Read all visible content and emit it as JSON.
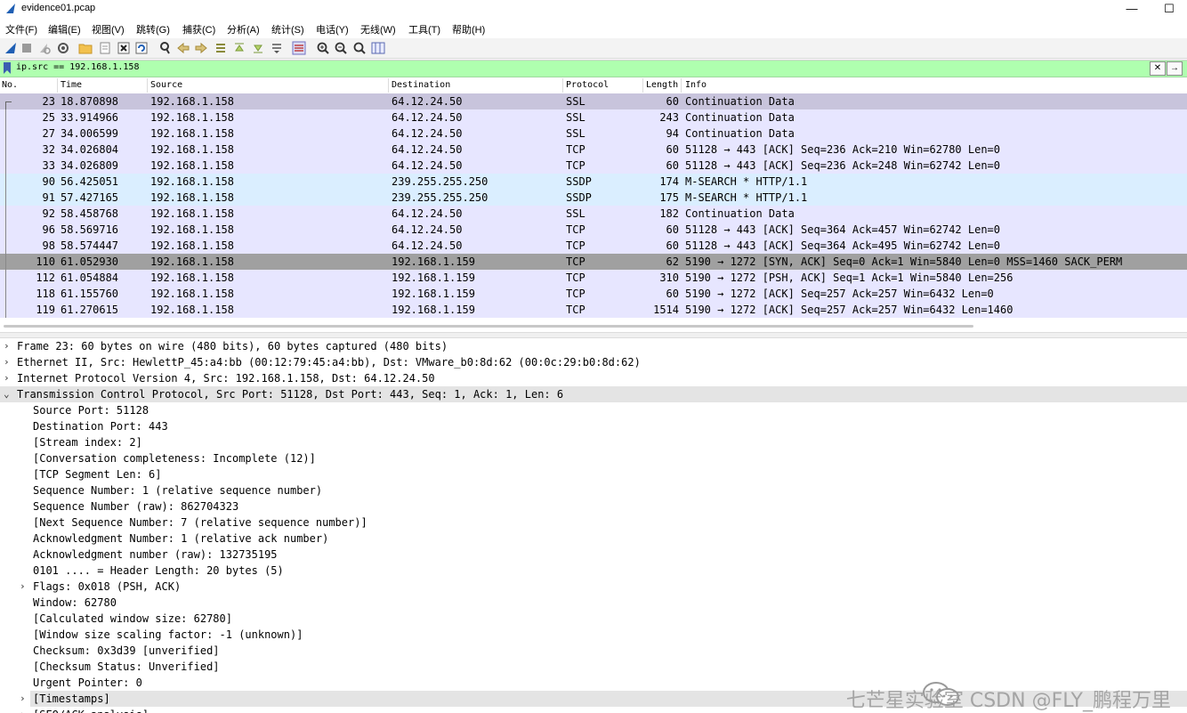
{
  "window": {
    "title": "evidence01.pcap",
    "minimize_glyph": "—",
    "maximize_glyph": "☐"
  },
  "menu": [
    "文件(F)",
    "编辑(E)",
    "视图(V)",
    "跳转(G)",
    "捕获(C)",
    "分析(A)",
    "统计(S)",
    "电话(Y)",
    "无线(W)",
    "工具(T)",
    "帮助(H)"
  ],
  "toolbar_icons": [
    "shark-fin-start-icon",
    "stop-icon",
    "restart-icon",
    "options-gear-icon",
    "open-folder-icon",
    "save-file-icon",
    "close-file-icon",
    "reload-icon",
    "find-packet-icon",
    "go-back-icon",
    "go-forward-icon",
    "go-to-packet-icon",
    "go-first-icon",
    "go-last-icon",
    "autoscroll-icon",
    "colorize-icon",
    "zoom-in-icon",
    "zoom-out-icon",
    "zoom-normal-icon",
    "resize-columns-icon"
  ],
  "filter": {
    "value": "ip.src == 192.168.1.158",
    "clear_glyph": "✕",
    "apply_glyph": "→"
  },
  "columns": {
    "no": "No.",
    "time": "Time",
    "source": "Source",
    "destination": "Destination",
    "protocol": "Protocol",
    "length": "Length",
    "info": "Info"
  },
  "packets": [
    {
      "no": "23",
      "time": "18.870898",
      "src": "192.168.1.158",
      "dst": "64.12.24.50",
      "proto": "SSL",
      "len": "60",
      "info": "Continuation Data",
      "style": "selected"
    },
    {
      "no": "25",
      "time": "33.914966",
      "src": "192.168.1.158",
      "dst": "64.12.24.50",
      "proto": "SSL",
      "len": "243",
      "info": "Continuation Data",
      "style": "tcp"
    },
    {
      "no": "27",
      "time": "34.006599",
      "src": "192.168.1.158",
      "dst": "64.12.24.50",
      "proto": "SSL",
      "len": "94",
      "info": "Continuation Data",
      "style": "tcp"
    },
    {
      "no": "32",
      "time": "34.026804",
      "src": "192.168.1.158",
      "dst": "64.12.24.50",
      "proto": "TCP",
      "len": "60",
      "info": "51128 → 443 [ACK] Seq=236 Ack=210 Win=62780 Len=0",
      "style": "tcp"
    },
    {
      "no": "33",
      "time": "34.026809",
      "src": "192.168.1.158",
      "dst": "64.12.24.50",
      "proto": "TCP",
      "len": "60",
      "info": "51128 → 443 [ACK] Seq=236 Ack=248 Win=62742 Len=0",
      "style": "tcp"
    },
    {
      "no": "90",
      "time": "56.425051",
      "src": "192.168.1.158",
      "dst": "239.255.255.250",
      "proto": "SSDP",
      "len": "174",
      "info": "M-SEARCH * HTTP/1.1",
      "style": "udp"
    },
    {
      "no": "91",
      "time": "57.427165",
      "src": "192.168.1.158",
      "dst": "239.255.255.250",
      "proto": "SSDP",
      "len": "175",
      "info": "M-SEARCH * HTTP/1.1",
      "style": "udp"
    },
    {
      "no": "92",
      "time": "58.458768",
      "src": "192.168.1.158",
      "dst": "64.12.24.50",
      "proto": "SSL",
      "len": "182",
      "info": "Continuation Data",
      "style": "tcp"
    },
    {
      "no": "96",
      "time": "58.569716",
      "src": "192.168.1.158",
      "dst": "64.12.24.50",
      "proto": "TCP",
      "len": "60",
      "info": "51128 → 443 [ACK] Seq=364 Ack=457 Win=62742 Len=0",
      "style": "tcp"
    },
    {
      "no": "98",
      "time": "58.574447",
      "src": "192.168.1.158",
      "dst": "64.12.24.50",
      "proto": "TCP",
      "len": "60",
      "info": "51128 → 443 [ACK] Seq=364 Ack=495 Win=62742 Len=0",
      "style": "tcp"
    },
    {
      "no": "110",
      "time": "61.052930",
      "src": "192.168.1.158",
      "dst": "192.168.1.159",
      "proto": "TCP",
      "len": "62",
      "info": "5190 → 1272 [SYN, ACK] Seq=0 Ack=1 Win=5840 Len=0 MSS=1460 SACK_PERM",
      "style": "syn"
    },
    {
      "no": "112",
      "time": "61.054884",
      "src": "192.168.1.158",
      "dst": "192.168.1.159",
      "proto": "TCP",
      "len": "310",
      "info": "5190 → 1272 [PSH, ACK] Seq=1 Ack=1 Win=5840 Len=256",
      "style": "tcp"
    },
    {
      "no": "118",
      "time": "61.155760",
      "src": "192.168.1.158",
      "dst": "192.168.1.159",
      "proto": "TCP",
      "len": "60",
      "info": "5190 → 1272 [ACK] Seq=257 Ack=257 Win=6432 Len=0",
      "style": "tcp"
    },
    {
      "no": "119",
      "time": "61.270615",
      "src": "192.168.1.158",
      "dst": "192.168.1.159",
      "proto": "TCP",
      "len": "1514",
      "info": "5190 → 1272 [ACK] Seq=257 Ack=257 Win=6432 Len=1460",
      "style": "tcp"
    }
  ],
  "row_colors": {
    "selected": "#c8c4dc",
    "tcp": "#e7e6ff",
    "udp": "#daeeff",
    "syn": "#a0a0a0",
    "detail_highlight": "#e4e4e4"
  },
  "details": [
    {
      "indent": 0,
      "arrow": "›",
      "text": "Frame 23: 60 bytes on wire (480 bits), 60 bytes captured (480 bits)",
      "hl": false
    },
    {
      "indent": 0,
      "arrow": "›",
      "text": "Ethernet II, Src: HewlettP_45:a4:bb (00:12:79:45:a4:bb), Dst: VMware_b0:8d:62 (00:0c:29:b0:8d:62)",
      "hl": false
    },
    {
      "indent": 0,
      "arrow": "›",
      "text": "Internet Protocol Version 4, Src: 192.168.1.158, Dst: 64.12.24.50",
      "hl": false
    },
    {
      "indent": 0,
      "arrow": "⌄",
      "text": "Transmission Control Protocol, Src Port: 51128, Dst Port: 443, Seq: 1, Ack: 1, Len: 6",
      "hl": true
    },
    {
      "indent": 1,
      "arrow": "",
      "text": "Source Port: 51128",
      "hl": false
    },
    {
      "indent": 1,
      "arrow": "",
      "text": "Destination Port: 443",
      "hl": false
    },
    {
      "indent": 1,
      "arrow": "",
      "text": "[Stream index: 2]",
      "hl": false
    },
    {
      "indent": 1,
      "arrow": "",
      "text": "[Conversation completeness: Incomplete (12)]",
      "hl": false
    },
    {
      "indent": 1,
      "arrow": "",
      "text": "[TCP Segment Len: 6]",
      "hl": false
    },
    {
      "indent": 1,
      "arrow": "",
      "text": "Sequence Number: 1    (relative sequence number)",
      "hl": false
    },
    {
      "indent": 1,
      "arrow": "",
      "text": "Sequence Number (raw): 862704323",
      "hl": false
    },
    {
      "indent": 1,
      "arrow": "",
      "text": "[Next Sequence Number: 7    (relative sequence number)]",
      "hl": false
    },
    {
      "indent": 1,
      "arrow": "",
      "text": "Acknowledgment Number: 1    (relative ack number)",
      "hl": false
    },
    {
      "indent": 1,
      "arrow": "",
      "text": "Acknowledgment number (raw): 132735195",
      "hl": false
    },
    {
      "indent": 1,
      "arrow": "",
      "text": "0101 .... = Header Length: 20 bytes (5)",
      "hl": false
    },
    {
      "indent": 1,
      "arrow": "›",
      "text": "Flags: 0x018 (PSH, ACK)",
      "hl": false
    },
    {
      "indent": 1,
      "arrow": "",
      "text": "Window: 62780",
      "hl": false
    },
    {
      "indent": 1,
      "arrow": "",
      "text": "[Calculated window size: 62780]",
      "hl": false
    },
    {
      "indent": 1,
      "arrow": "",
      "text": "[Window size scaling factor: -1 (unknown)]",
      "hl": false
    },
    {
      "indent": 1,
      "arrow": "",
      "text": "Checksum: 0x3d39 [unverified]",
      "hl": false
    },
    {
      "indent": 1,
      "arrow": "",
      "text": "[Checksum Status: Unverified]",
      "hl": false
    },
    {
      "indent": 1,
      "arrow": "",
      "text": "Urgent Pointer: 0",
      "hl": false
    },
    {
      "indent": 1,
      "arrow": "›",
      "text": "[Timestamps]",
      "hl": true
    },
    {
      "indent": 1,
      "arrow": "›",
      "text": "[SEQ/ACK analysis]",
      "hl": false
    }
  ],
  "watermark": {
    "text": "七芒星实验室 CSDN @FLY_鹏程万里"
  }
}
